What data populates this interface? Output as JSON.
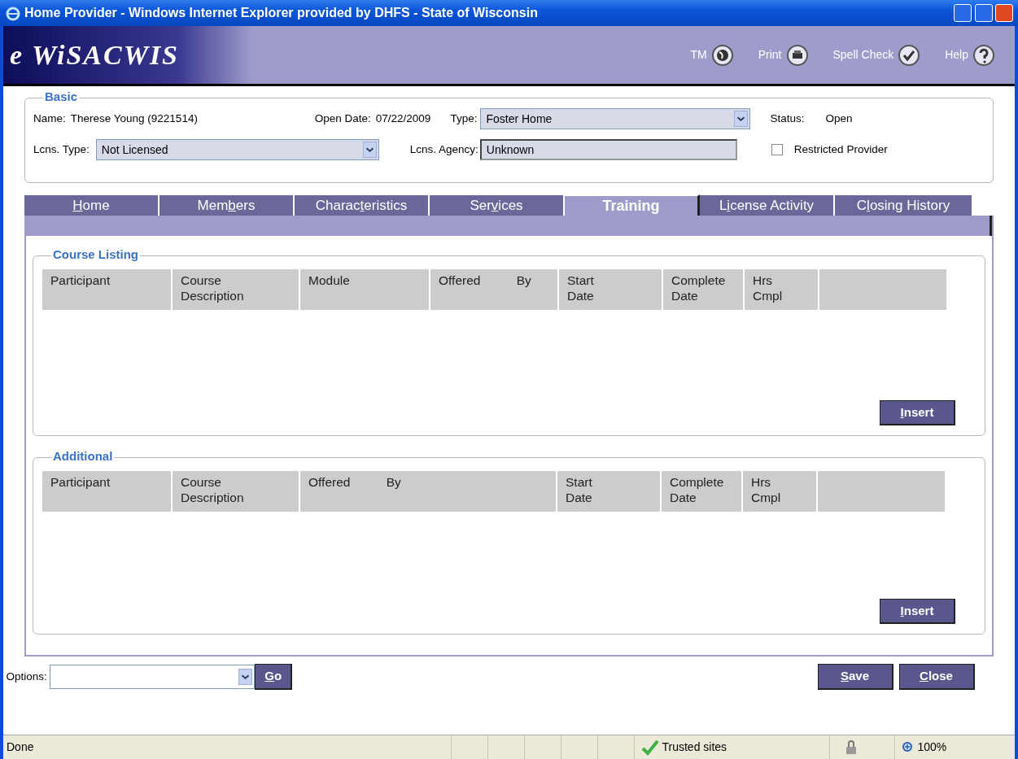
{
  "window": {
    "title": "Home Provider - Windows Internet Explorer provided by DHFS - State of Wisconsin"
  },
  "app_header": {
    "logo": "e WiSACWIS",
    "tools": [
      {
        "label": "TM",
        "kind": "globe"
      },
      {
        "label": "Print",
        "kind": "printer"
      },
      {
        "label": "Spell Check",
        "kind": "spell"
      },
      {
        "label": "Help",
        "kind": "help"
      }
    ]
  },
  "basic": {
    "legend": "Basic",
    "name_label": "Name:",
    "name_value": "Therese Young (9221514)",
    "open_date_label": "Open Date:",
    "open_date_value": "07/22/2009",
    "type_label": "Type:",
    "type_value": "Foster Home",
    "status_label": "Status:",
    "status_value": "Open",
    "lcns_type_label": "Lcns. Type:",
    "lcns_type_value": "Not Licensed",
    "lcns_agency_label": "Lcns. Agency:",
    "lcns_agency_value": "Unknown",
    "restricted": {
      "label": "Restricted Provider",
      "checked": false
    }
  },
  "tabs": [
    {
      "key": "H",
      "post": "ome",
      "selected": false
    },
    {
      "pre": "Mem",
      "key": "b",
      "post": "ers",
      "selected": false
    },
    {
      "pre": "Charac",
      "key": "t",
      "post": "eristics",
      "selected": false
    },
    {
      "pre": "Ser",
      "key": "v",
      "post": "ices",
      "selected": false
    },
    {
      "pre": "Training",
      "selected": true
    },
    {
      "pre": "L",
      "key": "i",
      "post": "cense Activity",
      "selected": false
    },
    {
      "pre": "C",
      "key": "l",
      "post": "osing History",
      "selected": false
    }
  ],
  "sections": [
    {
      "legend": "Course Listing",
      "columns": [
        "Participant",
        "Course Description",
        "Module",
        "Offered By",
        "Start Date",
        "Complete Date",
        "Hrs Cmpl"
      ],
      "insert_button": {
        "key": "I",
        "post": "nsert"
      }
    },
    {
      "legend": "Additional",
      "columns": [
        "Participant",
        "Course Description",
        "Offered By",
        "Start Date",
        "Complete Date",
        "Hrs Cmpl"
      ],
      "insert_button": {
        "key": "I",
        "post": "nsert"
      }
    }
  ],
  "options": {
    "label": "Options:",
    "go_button": {
      "key": "G",
      "post": "o"
    }
  },
  "action_buttons": [
    {
      "key": "S",
      "post": "ave"
    },
    {
      "key": "C",
      "post": "lose"
    }
  ],
  "status_bar": {
    "text": "Done",
    "zone": "Trusted sites",
    "zoom": "100%"
  }
}
